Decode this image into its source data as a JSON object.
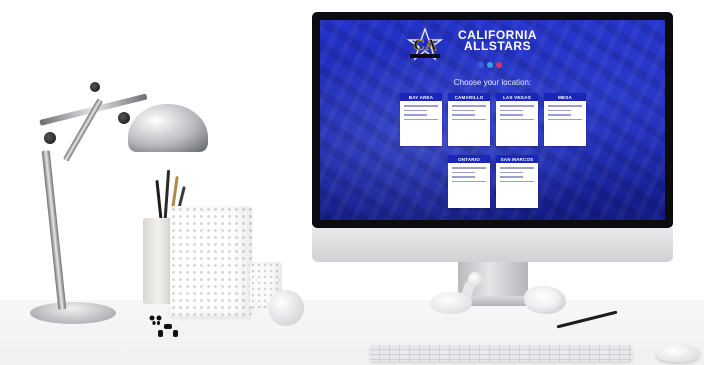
{
  "screen": {
    "brand_line1": "CALIFORNIA",
    "brand_line2": "ALLSTARS",
    "prompt": "Choose your location:",
    "accent_color": "#1a26b8",
    "social_icons": [
      "facebook-icon",
      "twitter-icon",
      "instagram-icon"
    ],
    "locations_row1": [
      "BAY AREA",
      "CAMARILLO",
      "LAS VEGAS",
      "MESA"
    ],
    "locations_row2": [
      "ONTARIO",
      "SAN MARCOS"
    ]
  }
}
